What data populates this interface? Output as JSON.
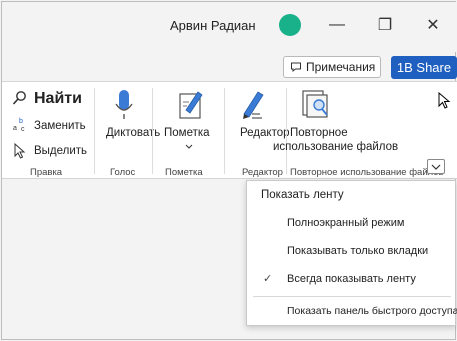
{
  "titlebar": {
    "user_name": "Арвин Радиан",
    "avatar_color": "#19b18a",
    "minimize_glyph": "—",
    "restore_glyph": "❐",
    "close_glyph": "✕"
  },
  "toolbar": {
    "notes_label": "Примечания",
    "share_label": "1B Share",
    "share_color": "#1f5fbf"
  },
  "ribbon": {
    "groups": [
      {
        "label": "Правка",
        "items": [
          "Найти",
          "Заменить",
          "Выделить"
        ]
      },
      {
        "label": "Голос",
        "items": [
          "Диктовать"
        ]
      },
      {
        "label": "Пометка",
        "items": [
          "Пометка"
        ]
      },
      {
        "label": "Редактор",
        "items": [
          "Редактор"
        ]
      },
      {
        "label": "Повторное использование файлов",
        "items": [
          "Повторное",
          "использование файлов"
        ]
      }
    ]
  },
  "menu": {
    "header": "Показать ленту",
    "items": [
      {
        "label": "Полноэкранный режим",
        "checked": false
      },
      {
        "label": "Показывать только вкладки",
        "checked": false
      },
      {
        "label": "Всегда показывать ленту",
        "checked": true
      },
      {
        "label": "Показать панель быстрого доступа",
        "checked": false
      }
    ],
    "check_glyph": "✓"
  }
}
